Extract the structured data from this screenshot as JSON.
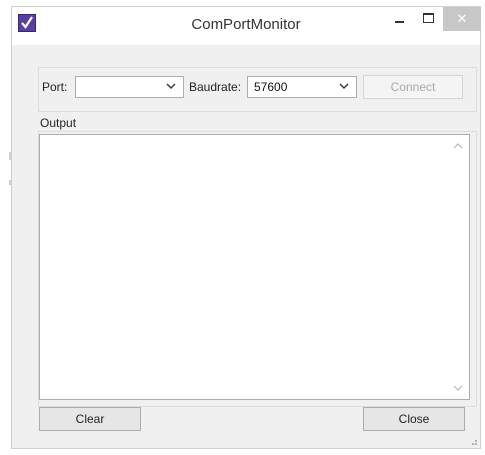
{
  "window": {
    "title": "ComPortMonitor",
    "close_glyph": "✕"
  },
  "port": {
    "label": "Port:",
    "value": ""
  },
  "baudrate": {
    "label": "Baudrate:",
    "value": "57600"
  },
  "buttons": {
    "connect": "Connect",
    "clear": "Clear",
    "close": "Close"
  },
  "output": {
    "legend": "Output",
    "text": ""
  },
  "icons": {
    "app": "app-checkmark-icon",
    "minimize": "minimize-icon",
    "maximize": "maximize-icon",
    "close": "close-icon",
    "dropdown": "chevron-down-icon",
    "scroll_up": "scroll-up-icon",
    "scroll_down": "scroll-down-icon",
    "grip": "resize-grip-icon"
  },
  "colors": {
    "app_icon": "#5b3fa0",
    "close_button": "#c7c7c7",
    "window_bg": "#f0f0f0"
  }
}
